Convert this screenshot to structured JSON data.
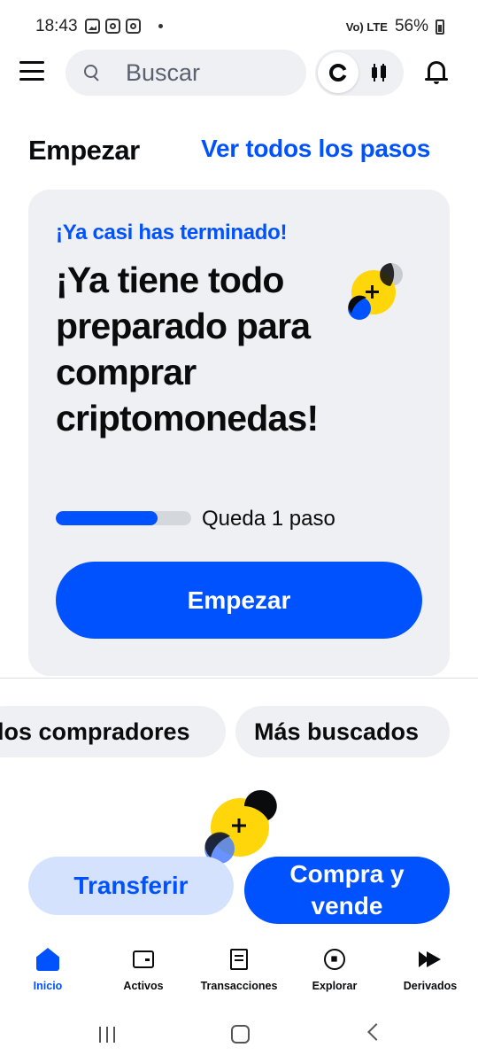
{
  "status_bar": {
    "time": "18:43",
    "wifi_label": "Vo) LTE",
    "battery": "56%"
  },
  "header": {
    "search_placeholder": "Buscar",
    "toggle_icons": [
      "coinbase-c-icon",
      "candlestick-icon"
    ],
    "notification_icon": "bell-icon"
  },
  "section": {
    "title": "Empezar",
    "link": "Ver todos los pasos"
  },
  "card": {
    "eyebrow": "¡Ya casi has terminado!",
    "title": "¡Ya tiene todo preparado para comprar criptomonedas!",
    "progress_fraction": 0.75,
    "progress_text": "Queda 1 paso",
    "button": "Empezar"
  },
  "chips": [
    "los compradores",
    "Más buscados"
  ],
  "actions": {
    "transfer": "Transferir",
    "buy_sell": "Compra y vende"
  },
  "bottom_nav": [
    {
      "label": "Inicio",
      "icon": "home-icon",
      "active": true
    },
    {
      "label": "Activos",
      "icon": "wallet-icon",
      "active": false
    },
    {
      "label": "Transacciones",
      "icon": "receipt-icon",
      "active": false
    },
    {
      "label": "Explorar",
      "icon": "compass-icon",
      "active": false
    },
    {
      "label": "Derivados",
      "icon": "derivatives-icon",
      "active": false
    }
  ],
  "colors": {
    "primary": "#0052ff",
    "surface": "#eef0f3",
    "text": "#0a0b0d",
    "secondary_button": "#d5e2fe",
    "illustration_yellow": "#ffd60a",
    "illustration_grey": "#c8cbd1"
  }
}
